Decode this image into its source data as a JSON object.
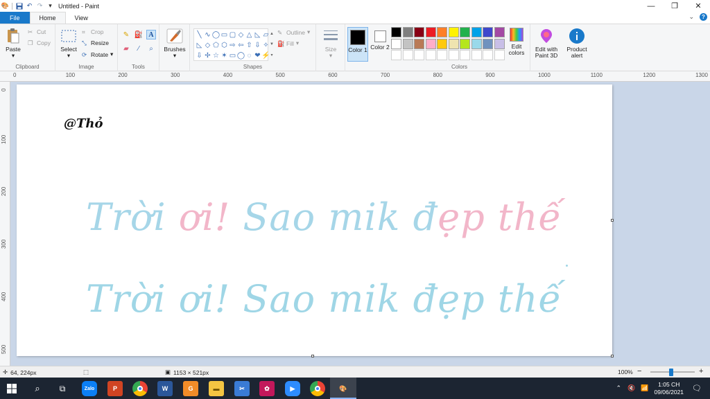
{
  "window": {
    "title": "Untitled - Paint",
    "minimize": "—",
    "maximize": "❐",
    "close": "✕"
  },
  "tabs": {
    "file": "File",
    "home": "Home",
    "view": "View",
    "expand": "⌄",
    "help": "?"
  },
  "ribbon": {
    "clipboard": {
      "label": "Clipboard",
      "paste": "Paste",
      "cut": "Cut",
      "copy": "Copy"
    },
    "image": {
      "label": "Image",
      "select": "Select",
      "crop": "Crop",
      "resize": "Resize",
      "rotate": "Rotate"
    },
    "tools": {
      "label": "Tools"
    },
    "brushes": {
      "label": "Brushes"
    },
    "shapes": {
      "label": "Shapes",
      "outline": "Outline",
      "fill": "Fill",
      "items": [
        "╲",
        "∿",
        "◯",
        "▭",
        "▢",
        "◇",
        "△",
        "◺",
        "▱",
        "◺",
        "◇",
        "⬠",
        "⬡",
        "⇨",
        "⇦",
        "⇧",
        "⇩",
        "✧",
        "⇩",
        "✢",
        "☆",
        "✶",
        "▭",
        "◯",
        "◌",
        "❤",
        "⚡"
      ]
    },
    "size": {
      "label": "Size"
    },
    "colors": {
      "label": "Colors",
      "color1": "Color 1",
      "color2": "Color 2",
      "color1_value": "#000000",
      "color2_value": "#ffffff",
      "edit_colors": "Edit colors",
      "palette": [
        "#000000",
        "#7f7f7f",
        "#880015",
        "#ed1c24",
        "#ff7f27",
        "#fff200",
        "#22b14c",
        "#00a2e8",
        "#3f48cc",
        "#a349a4",
        "#ffffff",
        "#c3c3c3",
        "#b97a57",
        "#ffaec9",
        "#ffc90e",
        "#efe4b0",
        "#b5e61d",
        "#99d9ea",
        "#7092be",
        "#c8bfe7",
        "",
        "",
        "",
        "",
        "",
        "",
        "",
        "",
        "",
        ""
      ]
    },
    "paint3d": "Edit with Paint 3D",
    "product_alert": "Product alert"
  },
  "ruler": {
    "top": [
      "0",
      "100",
      "200",
      "300",
      "400",
      "500",
      "600",
      "700",
      "800",
      "900",
      "1000",
      "1100",
      "1200",
      "1300"
    ],
    "left": [
      "0",
      "100",
      "200",
      "300",
      "400",
      "500"
    ]
  },
  "canvas": {
    "signature": "@Thỏ",
    "line1": "Trời ơi! Sao mik đẹp thế",
    "line2": "Trời ơi! Sao mik đẹp thế",
    "line1_start_color": "#a6d6e8",
    "line1_mid_color": "#f2b6c9",
    "line2_color": "#9fd6e6"
  },
  "status": {
    "cursor_pos": "64, 224px",
    "selection_size": "",
    "canvas_size": "1153 × 521px",
    "zoom": "100%",
    "zoom_out": "−",
    "zoom_in": "+"
  },
  "taskbar": {
    "time": "1:05 CH",
    "date": "09/06/2021"
  }
}
